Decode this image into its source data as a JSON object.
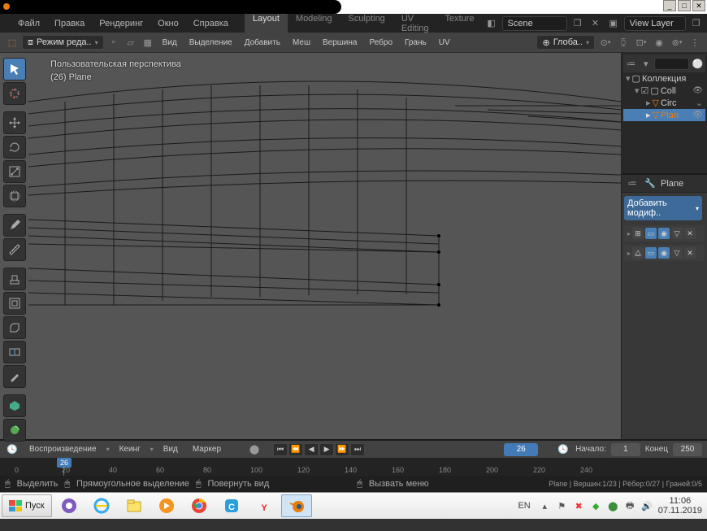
{
  "titlebar": {
    "minimize": "_",
    "maximize": "□",
    "close": "✕"
  },
  "menu": {
    "file": "Файл",
    "edit": "Правка",
    "render": "Рендеринг",
    "window": "Окно",
    "help": "Справка"
  },
  "workspace": {
    "layout": "Layout",
    "modeling": "Modeling",
    "sculpting": "Sculpting",
    "uv": "UV Editing",
    "texture": "Texture"
  },
  "scene_label": "Scene",
  "viewlayer_label": "View Layer",
  "header": {
    "mode": "Режим реда..",
    "view": "Вид",
    "select": "Выделение",
    "add": "Добавить",
    "mesh": "Меш",
    "vertex": "Вершина",
    "edge": "Ребро",
    "face": "Грань",
    "uv": "UV",
    "orient": "Глоба.."
  },
  "vp": {
    "persp": "Пользовательская перспектива",
    "obj": "(26) Plane"
  },
  "outliner": {
    "collection": "Коллекция",
    "coll": "Coll",
    "circ": "Circ",
    "plane": "Plan"
  },
  "props": {
    "obj": "Plane",
    "add_mod": "Добавить модиф.."
  },
  "timeline": {
    "play": "Воспроизведение",
    "keying": "Кеинг",
    "view": "Вид",
    "marker": "Маркер",
    "frame": "26",
    "start_l": "Начало:",
    "start": "1",
    "end_l": "Конец",
    "end": "250",
    "ticks": [
      "0",
      "20",
      "40",
      "60",
      "80",
      "100",
      "120",
      "140",
      "160",
      "180",
      "200",
      "220",
      "240"
    ]
  },
  "status": {
    "select": "Выделить",
    "box": "Прямоугольное выделение",
    "rotate": "Повернуть вид",
    "menu": "Вызвать меню",
    "info": "Plane | Вершин:1/23 | Рёбер:0/27 | Граней:0/5"
  },
  "taskbar": {
    "start": "Пуск",
    "lang": "EN",
    "time": "11:06",
    "date": "07.11.2019"
  }
}
